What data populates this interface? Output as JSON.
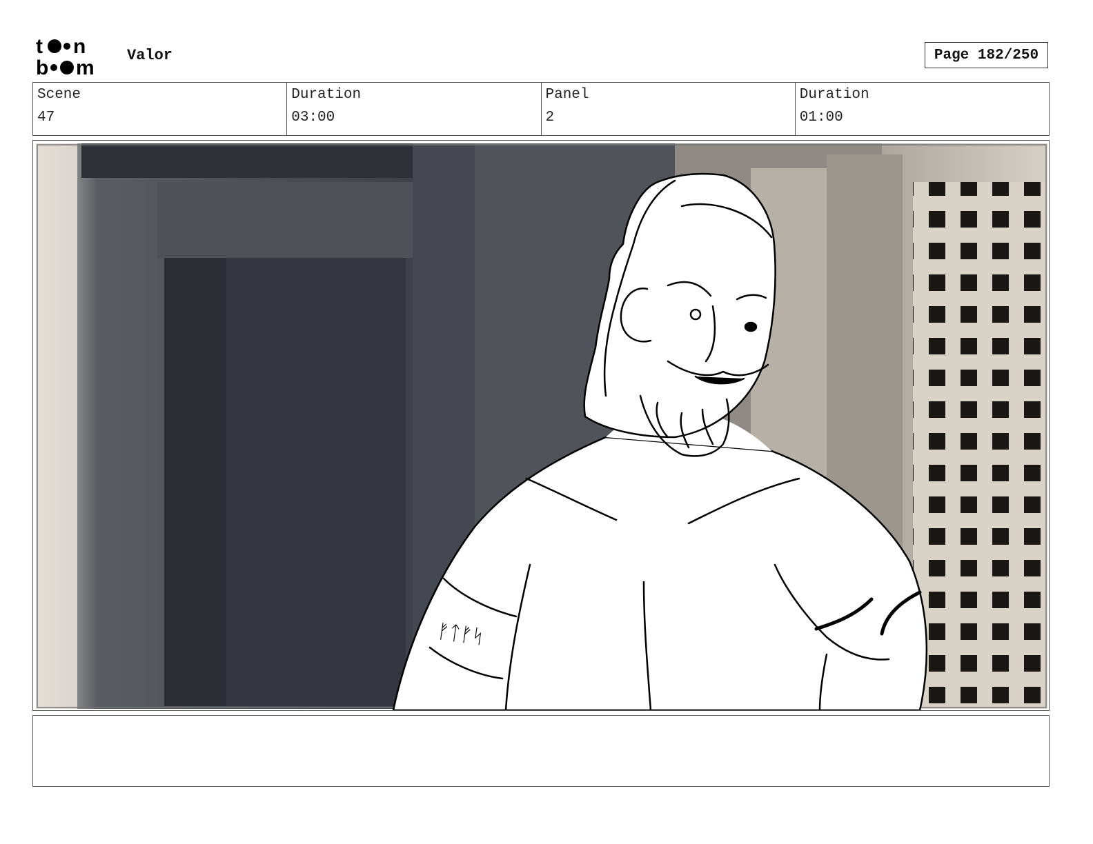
{
  "header": {
    "logo": "toon-boom-logo",
    "logo_text": [
      "toon",
      "boom"
    ],
    "project_title": "Valor",
    "page_label": "Page 182/250"
  },
  "info": {
    "scene_label": "Scene",
    "scene_value": "47",
    "scene_duration_label": "Duration",
    "scene_duration_value": "03:00",
    "panel_label": "Panel",
    "panel_value": "2",
    "panel_duration_label": "Duration",
    "panel_duration_value": "01:00"
  },
  "panel": {
    "description": "",
    "sketch": "character-sketch-over-photo-background"
  },
  "notes": {
    "text": ""
  },
  "colors": {
    "background": "#ffffff",
    "border": "#555555",
    "text": "#111111"
  }
}
